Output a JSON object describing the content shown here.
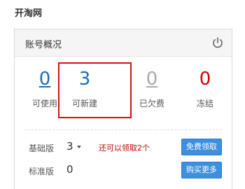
{
  "page": {
    "title": "开淘网"
  },
  "card": {
    "title": "账号概况",
    "power_icon": "power-icon"
  },
  "stats": [
    {
      "value": "0",
      "label": "可使用",
      "color": "#1a6eb8"
    },
    {
      "value": "3",
      "label": "可新建",
      "color": "#1a6eb8"
    },
    {
      "value": "0",
      "label": "已欠费",
      "color": "#aaaaaa"
    },
    {
      "value": "0",
      "label": "冻结",
      "color": "#d40000"
    }
  ],
  "rows": {
    "basic": {
      "label": "基础版",
      "count": "3",
      "hint": "还可以领取2个",
      "button": "免费领取"
    },
    "standard": {
      "label": "标准版",
      "count": "0",
      "button": "购买更多"
    }
  },
  "colors": {
    "accent_blue": "#3d8fe0",
    "highlight_red": "#d01010",
    "hint_red": "#c00000"
  }
}
